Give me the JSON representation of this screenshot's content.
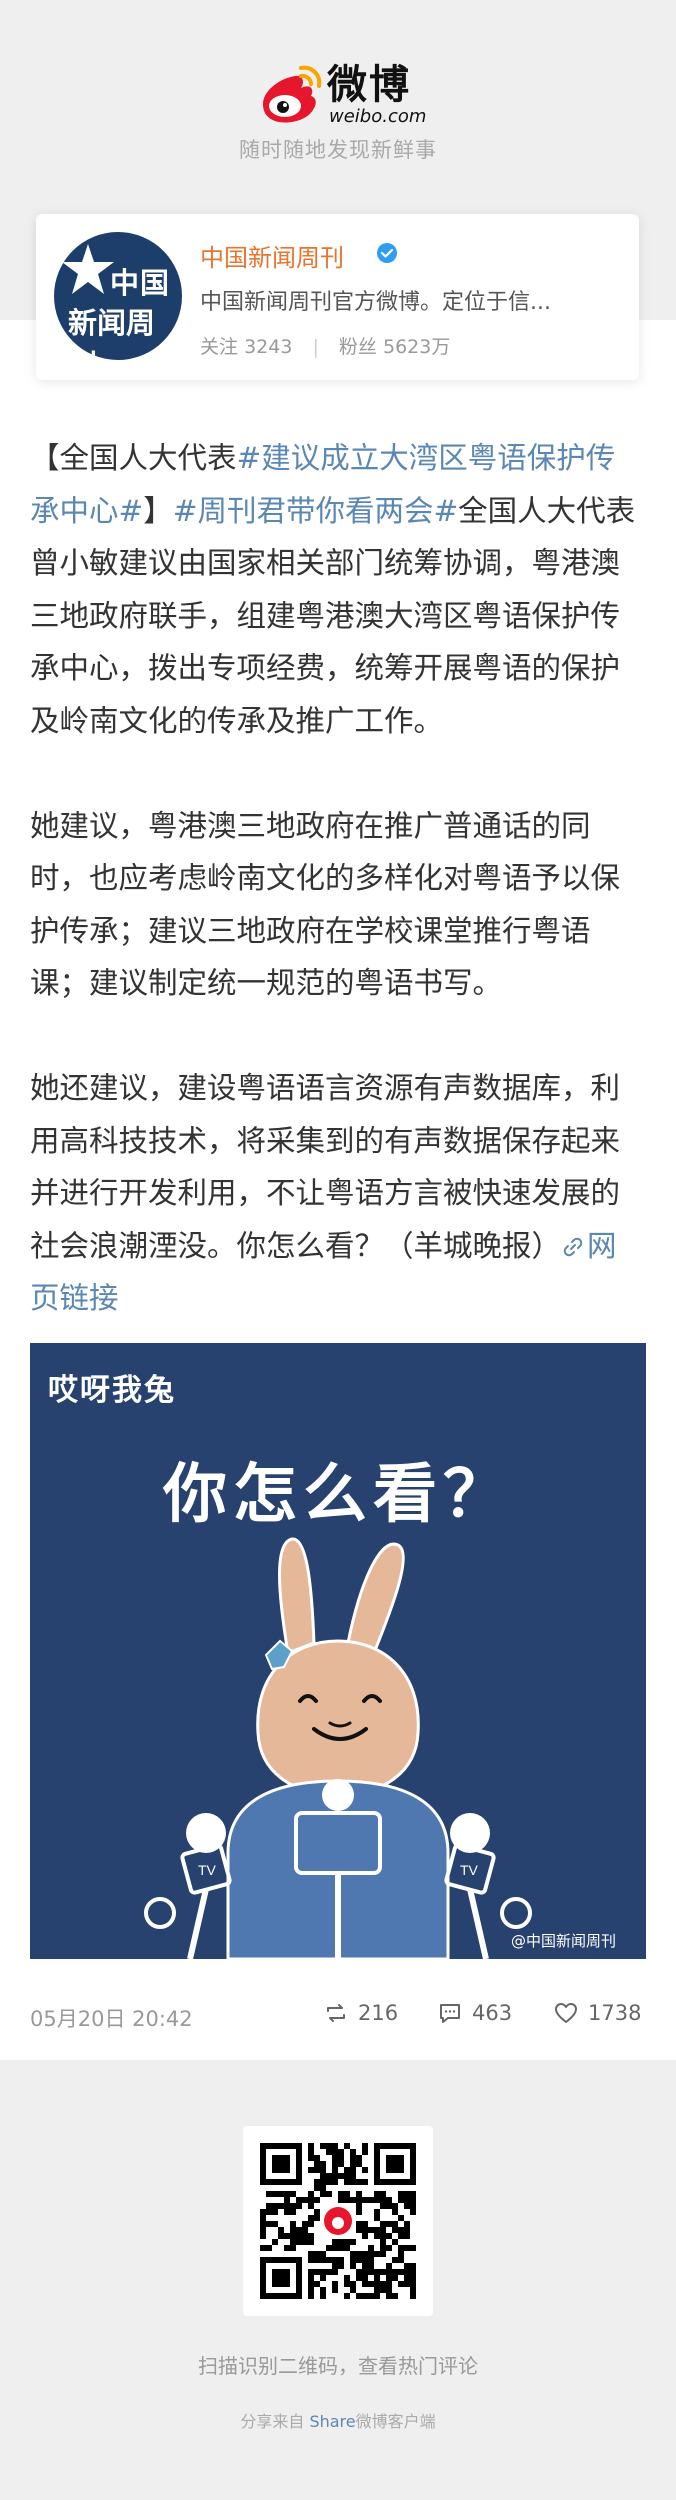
{
  "header": {
    "logo_cn": "微博",
    "logo_en": "weibo.com",
    "tagline": "随时随地发现新鲜事"
  },
  "account": {
    "avatar_line1": "中国",
    "avatar_line2": "新闻周刊",
    "name": "中国新闻周刊",
    "description": "中国新闻周刊官方微博。定位于信...",
    "following_label": "关注",
    "following_count": "3243",
    "separator": "|",
    "followers_label": "粉丝",
    "followers_count": "5623万"
  },
  "post": {
    "p1_bracket_open": "【全国人大代表",
    "p1_topic1": "#建议成立大湾区粤语保护传承中心#",
    "p1_bracket_close": "】",
    "p1_topic2": "#周刊君带你看两会#",
    "p1_rest": "全国人大代表曾小敏建议由国家相关部门统筹协调，粤港澳三地政府联手，组建粤港澳大湾区粤语保护传承中心，拨出专项经费，统筹开展粤语的保护及岭南文化的传承及推广工作。",
    "p2": "她建议，粤港澳三地政府在推广普通话的同时，也应考虑岭南文化的多样化对粤语予以保护传承；建议三地政府在学校课堂推行粤语课；建议制定统一规范的粤语书写。",
    "p3": "她还建议，建设粤语语言资源有声数据库，利用高科技技术，将采集到的有声数据保存起来并进行开发利用，不让粤语方言被快速发展的社会浪潮湮没。你怎么看？（羊城晚报）",
    "link_text": "网页链接",
    "image": {
      "tag": "哎呀我兔",
      "title": "你怎么看？",
      "mic_label": "TV",
      "watermark": "@中国新闻周刊"
    },
    "time": "05月20日 20:42",
    "reposts": "216",
    "comments": "463",
    "likes": "1738"
  },
  "footer": {
    "scan_text": "扫描识别二维码，查看热门评论",
    "share_prefix": "分享来自 ",
    "share_link": "Share",
    "share_suffix": "微博客户端"
  },
  "colors": {
    "accent_orange": "#e8742d",
    "link_blue": "#5b87b4",
    "verify_blue": "#2d9ef0",
    "image_bg": "#27426e"
  }
}
